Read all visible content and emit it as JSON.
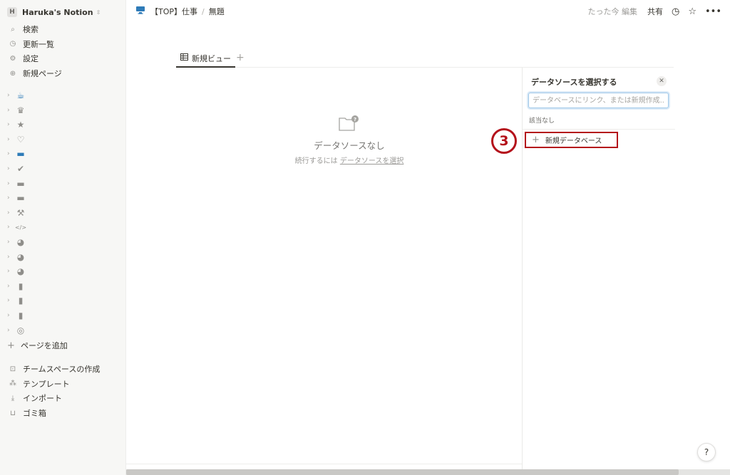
{
  "sidebar": {
    "workspace_initial": "H",
    "workspace_name": "Haruka's Notion",
    "workspace_caret": "⇳",
    "nav": [
      {
        "label": "検索",
        "icon": "search-icon",
        "glyph": "⌕"
      },
      {
        "label": "更新一覧",
        "icon": "clock-icon",
        "glyph": "◷"
      },
      {
        "label": "設定",
        "icon": "gear-icon",
        "glyph": "⚙"
      },
      {
        "label": "新規ページ",
        "icon": "plus-circle-icon",
        "glyph": "⊕"
      }
    ],
    "pages": [
      {
        "icon": "coffee-icon",
        "glyph": "☕",
        "color": "#2e7bb8"
      },
      {
        "icon": "crown-icon",
        "glyph": "♛",
        "color": "#8f8e8a"
      },
      {
        "icon": "star-icon",
        "glyph": "★",
        "color": "#8f8e8a"
      },
      {
        "icon": "heart-icon",
        "glyph": "♡",
        "color": "#8f8e8a"
      },
      {
        "icon": "monitor-icon",
        "glyph": "▬",
        "color": "#2e7bb8"
      },
      {
        "icon": "check-circle-icon",
        "glyph": "✔",
        "color": "#8f8e8a"
      },
      {
        "icon": "monitor-icon",
        "glyph": "▬",
        "color": "#8f8e8a"
      },
      {
        "icon": "monitor-icon",
        "glyph": "▬",
        "color": "#8f8e8a"
      },
      {
        "icon": "wrench-icon",
        "glyph": "⚒",
        "color": "#8f8e8a"
      },
      {
        "icon": "code-icon",
        "glyph": "</>",
        "color": "#8f8e8a"
      },
      {
        "icon": "palette-icon",
        "glyph": "◕",
        "color": "#8f8e8a"
      },
      {
        "icon": "palette-icon",
        "glyph": "◕",
        "color": "#8f8e8a"
      },
      {
        "icon": "palette-icon",
        "glyph": "◕",
        "color": "#8f8e8a"
      },
      {
        "icon": "book-icon",
        "glyph": "▮",
        "color": "#8f8e8a"
      },
      {
        "icon": "bookmark-icon",
        "glyph": "▮",
        "color": "#8f8e8a"
      },
      {
        "icon": "open-book-icon",
        "glyph": "▮",
        "color": "#8f8e8a"
      },
      {
        "icon": "target-icon",
        "glyph": "◎",
        "color": "#8f8e8a"
      }
    ],
    "add_page": "ページを追加",
    "bottom": [
      {
        "label": "チームスペースの作成",
        "icon": "team-icon",
        "glyph": "⊡"
      },
      {
        "label": "テンプレート",
        "icon": "shapes-icon",
        "glyph": "⁂"
      },
      {
        "label": "インポート",
        "icon": "import-icon",
        "glyph": "⤓"
      },
      {
        "label": "ゴミ箱",
        "icon": "trash-icon",
        "glyph": "⊔"
      }
    ]
  },
  "topbar": {
    "breadcrumb": [
      "【TOP】仕事",
      "無題"
    ],
    "breadcrumb_sep": "/",
    "edited": "たった今 編集",
    "share": "共有"
  },
  "view": {
    "tab_label": "新規ビュー",
    "add_tab": "+"
  },
  "empty_state": {
    "title": "データソースなし",
    "sub_prefix": "続行するには",
    "sub_link": "データソースを選択"
  },
  "panel": {
    "title": "データソースを選択する",
    "close": "✕",
    "search_placeholder": "データベースにリンク、または新規作成...",
    "no_match": "該当なし",
    "new_db": "新規データベース",
    "step": "3"
  },
  "help": "?"
}
